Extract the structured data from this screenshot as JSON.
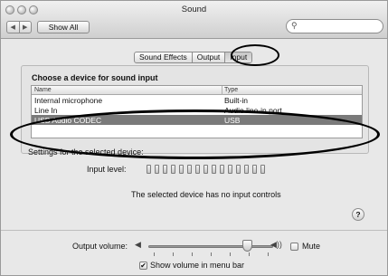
{
  "window": {
    "title": "Sound"
  },
  "toolbar": {
    "back_icon": "back-arrow-icon",
    "forward_icon": "forward-arrow-icon",
    "show_all_label": "Show All",
    "search_placeholder": "",
    "search_icon": "magnifier-icon"
  },
  "tabs": [
    {
      "label": "Sound Effects",
      "selected": false
    },
    {
      "label": "Output",
      "selected": false
    },
    {
      "label": "Input",
      "selected": true
    }
  ],
  "input_panel": {
    "heading": "Choose a device for sound input",
    "columns": [
      "Name",
      "Type"
    ],
    "rows": [
      {
        "name": "Internal microphone",
        "type": "Built-in",
        "selected": false
      },
      {
        "name": "Line In",
        "type": "Audio line-in port",
        "selected": false
      },
      {
        "name": "USB Audio CODEC",
        "type": "USB",
        "selected": true
      }
    ]
  },
  "settings": {
    "label": "Settings for the selected device:",
    "input_level_label": "Input level:",
    "input_level_segments": 15,
    "no_controls_text": "The selected device has no input controls",
    "help_label": "?"
  },
  "footer": {
    "output_volume_label": "Output volume:",
    "output_volume_level": 0.8,
    "mute_label": "Mute",
    "mute_checked": false,
    "show_in_menubar_label": "Show volume in menu bar",
    "show_in_menubar_checked": true,
    "check_mark": "✔"
  },
  "colors": {
    "selection": "#7a7a7a",
    "annotation_ring": "#000000"
  }
}
